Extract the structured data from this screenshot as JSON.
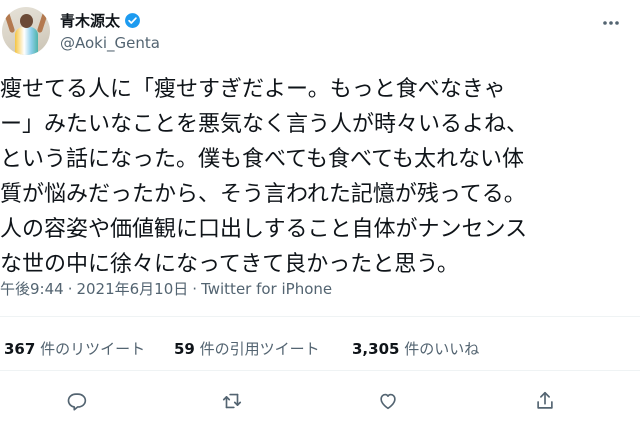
{
  "author": {
    "display_name": "青木源太",
    "handle": "@Aoki_Genta"
  },
  "tweet": {
    "lines": [
      "瘦せてる人に「瘦せすぎだよー。もっと食べなきゃ",
      "ー」みたいなことを悪気なく言う人が時々いるよね、",
      "という話になった。僕も食べても食べても太れない体",
      "質が悩みだったから、そう言われた記憶が残ってる。",
      "人の容姿や価値観に口出しすること自体がナンセンス",
      "な世の中に徐々になってきて良かったと思う。"
    ],
    "time": "午後9:44",
    "separator": "·",
    "date": "2021年6月10日",
    "source": "Twitter for iPhone"
  },
  "stats": {
    "retweets_count": "367",
    "retweets_label": "件のリツイート",
    "quotes_count": "59",
    "quotes_label": "件の引用ツイート",
    "likes_count": "3,305",
    "likes_label": "件のいいね"
  },
  "icons": {
    "verified": "verified-badge-icon",
    "more": "more-options-icon",
    "reply": "reply-icon",
    "retweet": "retweet-icon",
    "like": "heart-icon",
    "share": "share-icon"
  },
  "colors": {
    "verified": "#1d9bf0",
    "secondary_text": "#536471",
    "primary_text": "#0f1419",
    "divider": "#eff3f4"
  }
}
